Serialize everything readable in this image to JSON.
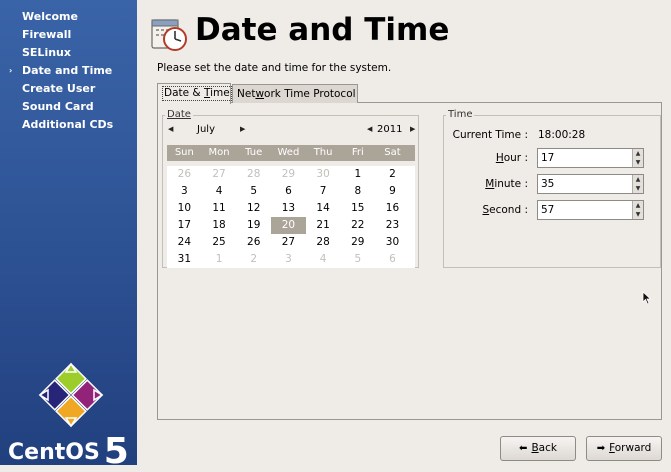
{
  "sidebar": {
    "items": [
      {
        "label": "Welcome"
      },
      {
        "label": "Firewall"
      },
      {
        "label": "SELinux"
      },
      {
        "label": "Date and Time",
        "current": true
      },
      {
        "label": "Create User"
      },
      {
        "label": "Sound Card"
      },
      {
        "label": "Additional CDs"
      }
    ],
    "current_marker": "›",
    "logo_text": "CentOS",
    "logo_number": "5"
  },
  "header": {
    "title": "Date and Time",
    "subtitle": "Please set the date and time for the system.",
    "icon": "clock-calendar-icon"
  },
  "tabs": [
    {
      "label": "Date & Time",
      "mnemonic": "T",
      "active": true
    },
    {
      "label": "Network Time Protocol",
      "mnemonic": "w",
      "active": false
    }
  ],
  "date": {
    "frame_label": "Date",
    "month": "July",
    "year": "2011",
    "weekdays": [
      "Sun",
      "Mon",
      "Tue",
      "Wed",
      "Thu",
      "Fri",
      "Sat"
    ],
    "weeks": [
      [
        {
          "d": "26",
          "o": true
        },
        {
          "d": "27",
          "o": true
        },
        {
          "d": "28",
          "o": true
        },
        {
          "d": "29",
          "o": true
        },
        {
          "d": "30",
          "o": true
        },
        {
          "d": "1"
        },
        {
          "d": "2"
        }
      ],
      [
        {
          "d": "3"
        },
        {
          "d": "4"
        },
        {
          "d": "5"
        },
        {
          "d": "6"
        },
        {
          "d": "7"
        },
        {
          "d": "8"
        },
        {
          "d": "9"
        }
      ],
      [
        {
          "d": "10"
        },
        {
          "d": "11"
        },
        {
          "d": "12"
        },
        {
          "d": "13"
        },
        {
          "d": "14"
        },
        {
          "d": "15"
        },
        {
          "d": "16"
        }
      ],
      [
        {
          "d": "17"
        },
        {
          "d": "18"
        },
        {
          "d": "19"
        },
        {
          "d": "20",
          "sel": true
        },
        {
          "d": "21"
        },
        {
          "d": "22"
        },
        {
          "d": "23"
        }
      ],
      [
        {
          "d": "24"
        },
        {
          "d": "25"
        },
        {
          "d": "26"
        },
        {
          "d": "27"
        },
        {
          "d": "28"
        },
        {
          "d": "29"
        },
        {
          "d": "30"
        }
      ],
      [
        {
          "d": "31"
        },
        {
          "d": "1",
          "o": true
        },
        {
          "d": "2",
          "o": true
        },
        {
          "d": "3",
          "o": true
        },
        {
          "d": "4",
          "o": true
        },
        {
          "d": "5",
          "o": true
        },
        {
          "d": "6",
          "o": true
        }
      ]
    ]
  },
  "time": {
    "frame_label": "Time",
    "current_label": "Current Time :",
    "current_value": "18:00:28",
    "hour_label": "Hour :",
    "hour_value": "17",
    "minute_label": "Minute :",
    "minute_value": "35",
    "second_label": "Second :",
    "second_value": "57"
  },
  "buttons": {
    "back": "Back",
    "forward": "Forward"
  },
  "colors": {
    "sidebar": "#2f5597",
    "selected_day": "#aba599",
    "background": "#efebe7"
  }
}
